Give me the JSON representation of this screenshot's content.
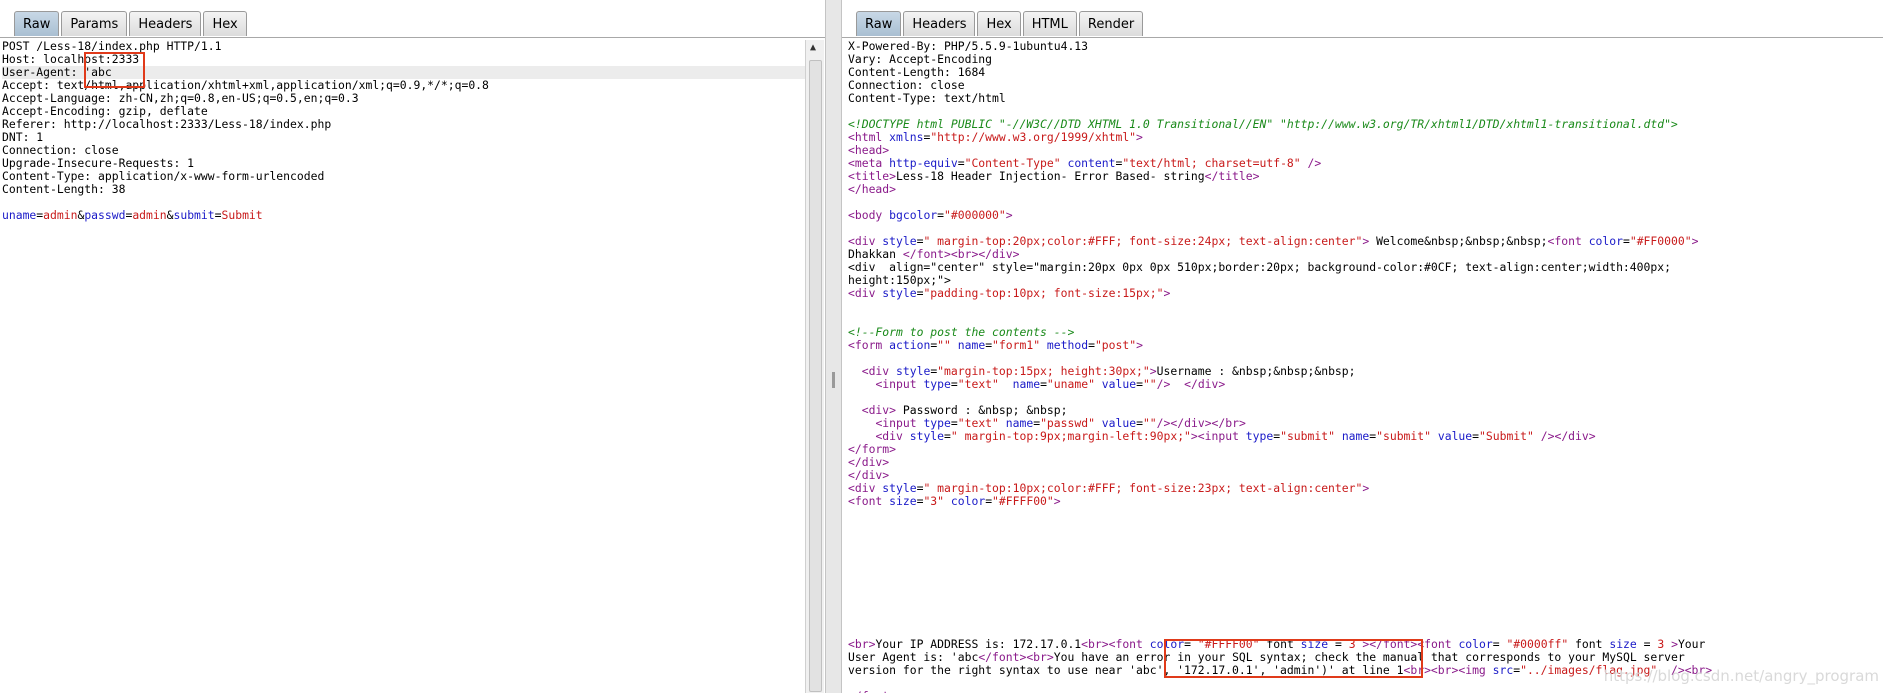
{
  "request": {
    "tabs": [
      "Raw",
      "Params",
      "Headers",
      "Hex"
    ],
    "active_tab": "Raw",
    "lines": [
      "POST /Less-18/index.php HTTP/1.1",
      "Host: localhost:2333",
      "User-Agent: 'abc",
      "Accept: text/html,application/xhtml+xml,application/xml;q=0.9,*/*;q=0.8",
      "Accept-Language: zh-CN,zh;q=0.8,en-US;q=0.5,en;q=0.3",
      "Accept-Encoding: gzip, deflate",
      "Referer: http://localhost:2333/Less-18/index.php",
      "DNT: 1",
      "Connection: close",
      "Upgrade-Insecure-Requests: 1",
      "Content-Type: application/x-www-form-urlencoded",
      "Content-Length: 38",
      "",
      "uname=admin&passwd=admin&submit=Submit"
    ],
    "body_params": [
      {
        "name": "uname",
        "value": "admin"
      },
      {
        "name": "passwd",
        "value": "admin"
      },
      {
        "name": "submit",
        "value": "Submit"
      }
    ]
  },
  "response": {
    "tabs": [
      "Raw",
      "Headers",
      "Hex",
      "HTML",
      "Render"
    ],
    "active_tab": "Raw",
    "lines": [
      "X-Powered-By: PHP/5.5.9-1ubuntu4.13",
      "Vary: Accept-Encoding",
      "Content-Length: 1684",
      "Connection: close",
      "Content-Type: text/html",
      "",
      "<!DOCTYPE html PUBLIC \"-//W3C//DTD XHTML 1.0 Transitional//EN\" \"http://www.w3.org/TR/xhtml1/DTD/xhtml1-transitional.dtd\">",
      "<html xmlns=\"http://www.w3.org/1999/xhtml\">",
      "<head>",
      "<meta http-equiv=\"Content-Type\" content=\"text/html; charset=utf-8\" />",
      "<title>Less-18 Header Injection- Error Based- string</title>",
      "</head>",
      "",
      "<body bgcolor=\"#000000\">",
      "",
      "<div style=\" margin-top:20px;color:#FFF; font-size:24px; text-align:center\"> Welcome&nbsp;&nbsp;&nbsp;<font color=\"#FF0000\">",
      "Dhakkan </font><br></div>",
      "<div  align=\"center\" style=\"margin:20px 0px 0px 510px;border:20px; background-color:#0CF; text-align:center;width:400px;",
      "height:150px;\">",
      "<div style=\"padding-top:10px; font-size:15px;\">",
      "",
      "",
      "<!--Form to post the contents -->",
      "<form action=\"\" name=\"form1\" method=\"post\">",
      "",
      "  <div style=\"margin-top:15px; height:30px;\">Username : &nbsp;&nbsp;&nbsp;",
      "    <input type=\"text\"  name=\"uname\" value=\"\"/>  </div>",
      "",
      "  <div> Password : &nbsp; &nbsp;",
      "    <input type=\"text\" name=\"passwd\" value=\"\"/></div></br>",
      "    <div style=\" margin-top:9px;margin-left:90px;\"><input type=\"submit\" name=\"submit\" value=\"Submit\" /></div>",
      "</form>",
      "</div>",
      "</div>",
      "<div style=\" margin-top:10px;color:#FFF; font-size:23px; text-align:center\">",
      "<font size=\"3\" color=\"#FFFF00\">",
      "",
      "",
      "",
      "",
      "",
      "",
      "",
      "",
      "",
      "",
      "<br>Your IP ADDRESS is: 172.17.0.1<br><font color= \"#FFFF00\" font size = 3 ></font><font color= \"#0000ff\" font size = 3 >Your",
      "User Agent is: 'abc</font><br>You have an error in your SQL syntax; check the manual that corresponds to your MySQL server",
      "version for the right syntax to use near 'abc', '172.17.0.1', 'admin')' at line 1<br><br><img src=\"../images/flag.jpg\"  /><br>",
      "",
      "</font>"
    ]
  },
  "watermark": "https://blog.csdn.net/angry_program"
}
